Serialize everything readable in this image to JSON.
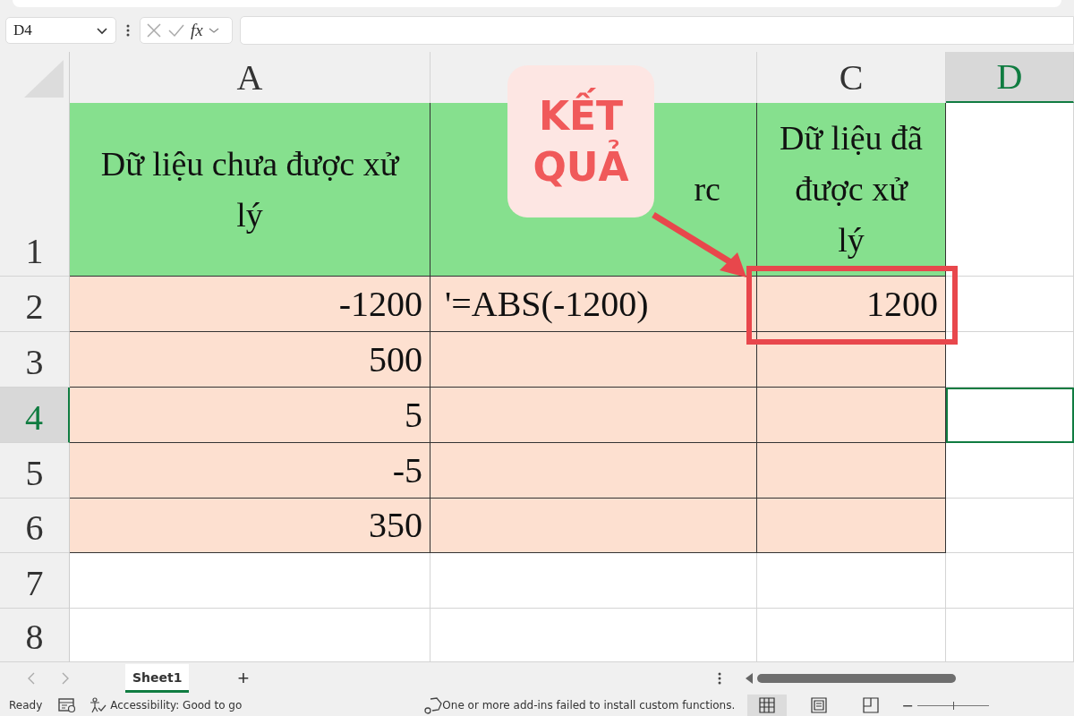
{
  "name_box": {
    "value": "D4"
  },
  "formula_bar": {
    "function_label": "fx"
  },
  "columns": [
    {
      "label": "A",
      "selected": false
    },
    {
      "selected": false
    },
    {
      "label": "C",
      "selected": false
    },
    {
      "label": "D",
      "selected": true
    }
  ],
  "rows": [
    {
      "number": "1",
      "selected": false,
      "kind": "header",
      "cells": [
        "Dữ liệu chưa được xử lý",
        "rc",
        "Dữ liệu đã được xử lý",
        null
      ]
    },
    {
      "number": "2",
      "selected": false,
      "kind": "data",
      "cells": [
        "-1200",
        "'=ABS(-1200)",
        "1200",
        null
      ]
    },
    {
      "number": "3",
      "selected": false,
      "kind": "data",
      "cells": [
        "500",
        null,
        null,
        null
      ]
    },
    {
      "number": "4",
      "selected": true,
      "kind": "data",
      "cells": [
        "5",
        null,
        null,
        null
      ]
    },
    {
      "number": "5",
      "selected": false,
      "kind": "data",
      "cells": [
        "-5",
        null,
        null,
        null
      ]
    },
    {
      "number": "6",
      "selected": false,
      "kind": "data",
      "cells": [
        "350",
        null,
        null,
        null
      ]
    },
    {
      "number": "7",
      "selected": false,
      "kind": "empty",
      "cells": [
        null,
        null,
        null,
        null
      ]
    },
    {
      "number": "8",
      "selected": false,
      "kind": "empty",
      "cells": [
        null,
        null,
        null,
        null
      ]
    }
  ],
  "annotation": {
    "label": "KẾT QUẢ"
  },
  "sheet_tabs": [
    {
      "label": "Sheet1",
      "selected": true
    }
  ],
  "add_sheet": "+",
  "status_bar": {
    "status": "Ready",
    "accessibility": "Accessibility: Good to go",
    "message": "One or more add-ins failed to install custom functions.",
    "views": [
      {
        "kind": "normal",
        "selected": true
      },
      {
        "kind": "page_layout",
        "selected": false
      },
      {
        "kind": "page_break",
        "selected": false
      }
    ],
    "zoom_out": "−",
    "zoom": {
      "level": 0.5
    }
  }
}
